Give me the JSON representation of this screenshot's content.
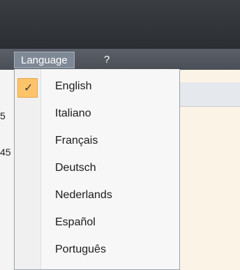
{
  "menubar": {
    "language": "Language",
    "help": "?"
  },
  "side": {
    "label_a": "5",
    "label_b": "45"
  },
  "languages": [
    {
      "label": "English",
      "checked": true
    },
    {
      "label": "Italiano",
      "checked": false
    },
    {
      "label": "Français",
      "checked": false
    },
    {
      "label": "Deutsch",
      "checked": false
    },
    {
      "label": "Nederlands",
      "checked": false
    },
    {
      "label": "Español",
      "checked": false
    },
    {
      "label": "Português",
      "checked": false
    }
  ],
  "icons": {
    "check": "✓"
  },
  "colors": {
    "menubar": "#4a4f57",
    "highlight": "#ffc46a",
    "menu_text": "#ffffff"
  }
}
